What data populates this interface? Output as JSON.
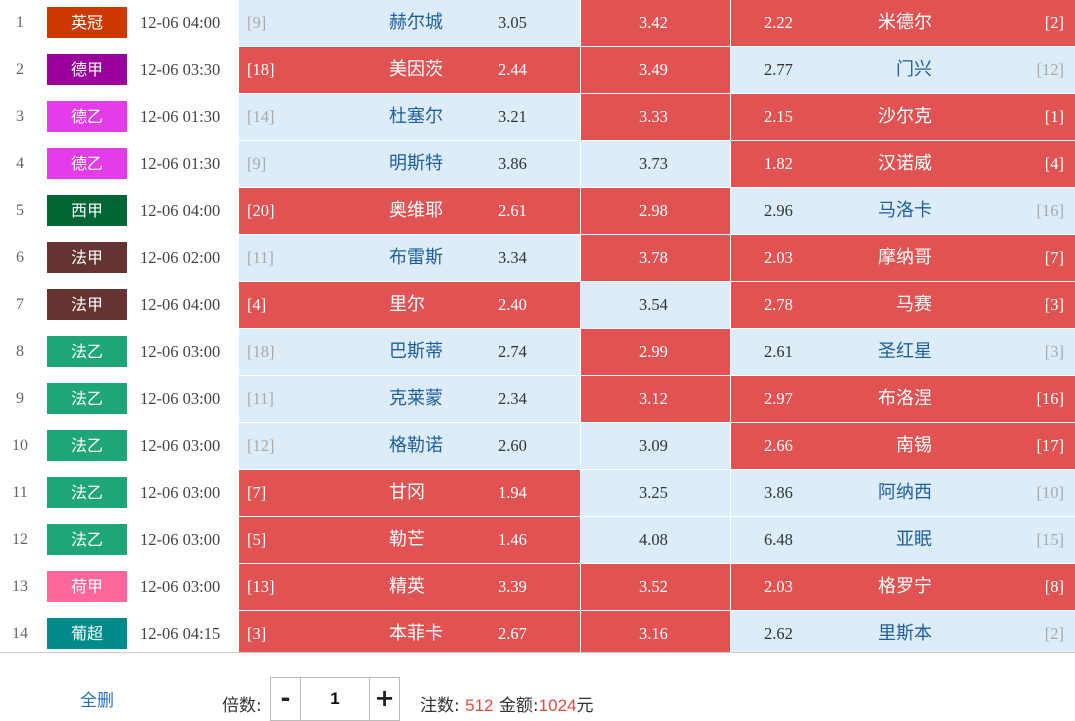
{
  "matches": [
    {
      "num": "1",
      "league": "英冠",
      "league_color": "#cc3a00",
      "time": "12-06 04:00",
      "home_rank": "[9]",
      "home": "赫尔城",
      "home_odds": "3.05",
      "draw_odds": "3.42",
      "away_odds": "2.22",
      "away": "米德尔",
      "away_rank": "[2]",
      "selected": [
        false,
        true,
        true
      ]
    },
    {
      "num": "2",
      "league": "德甲",
      "league_color": "#99009c",
      "time": "12-06 03:30",
      "home_rank": "[18]",
      "home": "美因茨",
      "home_odds": "2.44",
      "draw_odds": "3.49",
      "away_odds": "2.77",
      "away": "门兴",
      "away_rank": "[12]",
      "selected": [
        true,
        true,
        false
      ]
    },
    {
      "num": "3",
      "league": "德乙",
      "league_color": "#e33ce8",
      "time": "12-06 01:30",
      "home_rank": "[14]",
      "home": "杜塞尔",
      "home_odds": "3.21",
      "draw_odds": "3.33",
      "away_odds": "2.15",
      "away": "沙尔克",
      "away_rank": "[1]",
      "selected": [
        false,
        true,
        true
      ]
    },
    {
      "num": "4",
      "league": "德乙",
      "league_color": "#e33ce8",
      "time": "12-06 01:30",
      "home_rank": "[9]",
      "home": "明斯特",
      "home_odds": "3.86",
      "draw_odds": "3.73",
      "away_odds": "1.82",
      "away": "汉诺威",
      "away_rank": "[4]",
      "selected": [
        false,
        false,
        true
      ]
    },
    {
      "num": "5",
      "league": "西甲",
      "league_color": "#006633",
      "time": "12-06 04:00",
      "home_rank": "[20]",
      "home": "奥维耶",
      "home_odds": "2.61",
      "draw_odds": "2.98",
      "away_odds": "2.96",
      "away": "马洛卡",
      "away_rank": "[16]",
      "selected": [
        true,
        true,
        false
      ]
    },
    {
      "num": "6",
      "league": "法甲",
      "league_color": "#663333",
      "time": "12-06 02:00",
      "home_rank": "[11]",
      "home": "布雷斯",
      "home_odds": "3.34",
      "draw_odds": "3.78",
      "away_odds": "2.03",
      "away": "摩纳哥",
      "away_rank": "[7]",
      "selected": [
        false,
        true,
        true
      ]
    },
    {
      "num": "7",
      "league": "法甲",
      "league_color": "#663333",
      "time": "12-06 04:00",
      "home_rank": "[4]",
      "home": "里尔",
      "home_odds": "2.40",
      "draw_odds": "3.54",
      "away_odds": "2.78",
      "away": "马赛",
      "away_rank": "[3]",
      "selected": [
        true,
        false,
        true
      ]
    },
    {
      "num": "8",
      "league": "法乙",
      "league_color": "#1ea57a",
      "time": "12-06 03:00",
      "home_rank": "[18]",
      "home": "巴斯蒂",
      "home_odds": "2.74",
      "draw_odds": "2.99",
      "away_odds": "2.61",
      "away": "圣红星",
      "away_rank": "[3]",
      "selected": [
        false,
        true,
        false
      ]
    },
    {
      "num": "9",
      "league": "法乙",
      "league_color": "#1ea57a",
      "time": "12-06 03:00",
      "home_rank": "[11]",
      "home": "克莱蒙",
      "home_odds": "2.34",
      "draw_odds": "3.12",
      "away_odds": "2.97",
      "away": "布洛涅",
      "away_rank": "[16]",
      "selected": [
        false,
        true,
        true
      ]
    },
    {
      "num": "10",
      "league": "法乙",
      "league_color": "#1ea57a",
      "time": "12-06 03:00",
      "home_rank": "[12]",
      "home": "格勒诺",
      "home_odds": "2.60",
      "draw_odds": "3.09",
      "away_odds": "2.66",
      "away": "南锡",
      "away_rank": "[17]",
      "selected": [
        false,
        false,
        true
      ]
    },
    {
      "num": "11",
      "league": "法乙",
      "league_color": "#1ea57a",
      "time": "12-06 03:00",
      "home_rank": "[7]",
      "home": "甘冈",
      "home_odds": "1.94",
      "draw_odds": "3.25",
      "away_odds": "3.86",
      "away": "阿纳西",
      "away_rank": "[10]",
      "selected": [
        true,
        false,
        false
      ]
    },
    {
      "num": "12",
      "league": "法乙",
      "league_color": "#1ea57a",
      "time": "12-06 03:00",
      "home_rank": "[5]",
      "home": "勒芒",
      "home_odds": "1.46",
      "draw_odds": "4.08",
      "away_odds": "6.48",
      "away": "亚眠",
      "away_rank": "[15]",
      "selected": [
        true,
        false,
        false
      ]
    },
    {
      "num": "13",
      "league": "荷甲",
      "league_color": "#ff6699",
      "time": "12-06 03:00",
      "home_rank": "[13]",
      "home": "精英",
      "home_odds": "3.39",
      "draw_odds": "3.52",
      "away_odds": "2.03",
      "away": "格罗宁",
      "away_rank": "[8]",
      "selected": [
        true,
        true,
        true
      ]
    },
    {
      "num": "14",
      "league": "葡超",
      "league_color": "#008b8b",
      "time": "12-06 04:15",
      "home_rank": "[3]",
      "home": "本菲卡",
      "home_odds": "2.67",
      "draw_odds": "3.16",
      "away_odds": "2.62",
      "away": "里斯本",
      "away_rank": "[2]",
      "selected": [
        true,
        true,
        false
      ]
    }
  ],
  "footer": {
    "clear_label": "全删",
    "multiplier_label": "倍数:",
    "minus": "-",
    "plus": "+",
    "multiplier_value": "1",
    "bets_label": "注数:",
    "bets_value": "512",
    "amount_label": "金额:",
    "amount_value": "1024",
    "amount_unit": "元"
  },
  "colors": {
    "selected": "#e15252",
    "unselected": "#dcecf8"
  }
}
